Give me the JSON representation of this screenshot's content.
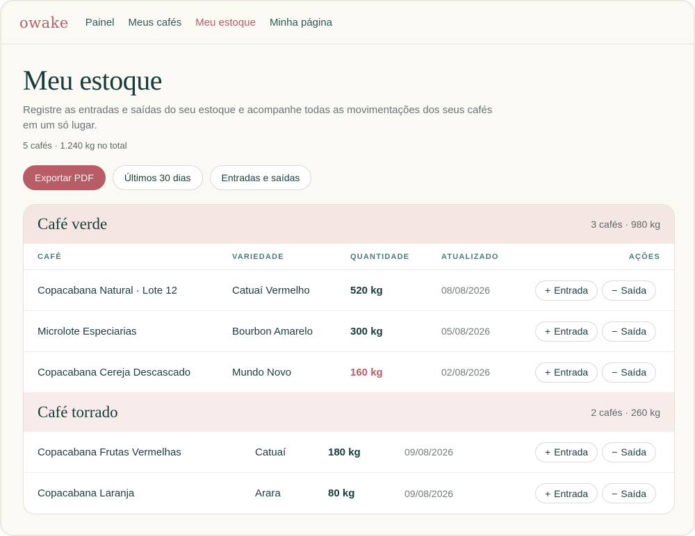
{
  "nav": {
    "logo": "owake",
    "items": [
      {
        "label": "Painel"
      },
      {
        "label": "Meus cafés"
      },
      {
        "label": "Meu estoque"
      },
      {
        "label": "Minha página"
      }
    ],
    "active_index": 2
  },
  "header": {
    "title": "Meu estoque",
    "subtitle": "Registre as entradas e saídas do seu estoque e acompanhe todas as movimentações dos seus cafés em um só lugar.",
    "summary": "5 cafés · 1.240 kg no total"
  },
  "toolbar": {
    "export_label": "Exportar PDF",
    "period_label": "Últimos 30 dias",
    "filter_label": "Entradas e saídas"
  },
  "columns": {
    "cafe": "CAFÉ",
    "variedade": "VARIEDADE",
    "quantidade": "QUANTIDADE",
    "atualizado": "ATUALIZADO",
    "acoes": "AÇÕES"
  },
  "actions": {
    "entrada": "Entrada",
    "saida": "Saída",
    "entrada_sym": "+",
    "saida_sym": "−"
  },
  "groups": [
    {
      "title": "Café verde",
      "meta": "3 cafés · 980 kg",
      "rows": [
        {
          "cafe": "Copacabana Natural · Lote 12",
          "variedade": "Catuaí Vermelho",
          "quantidade": "520 kg",
          "atualizado": "08/08/2026",
          "low": false
        },
        {
          "cafe": "Microlote Especiarias",
          "variedade": "Bourbon Amarelo",
          "quantidade": "300 kg",
          "atualizado": "05/08/2026",
          "low": false
        },
        {
          "cafe": "Copacabana Cereja Descascado",
          "variedade": "Mundo Novo",
          "quantidade": "160 kg",
          "atualizado": "02/08/2026",
          "low": true
        }
      ]
    },
    {
      "title": "Café torrado",
      "meta": "2 cafés · 260 kg",
      "rows": [
        {
          "cafe": "Copacabana Frutas Vermelhas",
          "variedade": "Catuaí",
          "quantidade": "180 kg",
          "atualizado": "09/08/2026",
          "low": false
        },
        {
          "cafe": "Copacabana Laranja",
          "variedade": "Arara",
          "quantidade": "80 kg",
          "atualizado": "09/08/2026",
          "low": false
        }
      ]
    }
  ],
  "colors": {
    "accent": "#b85d65",
    "ink": "#163b3b",
    "background": "#fbf9f4"
  }
}
